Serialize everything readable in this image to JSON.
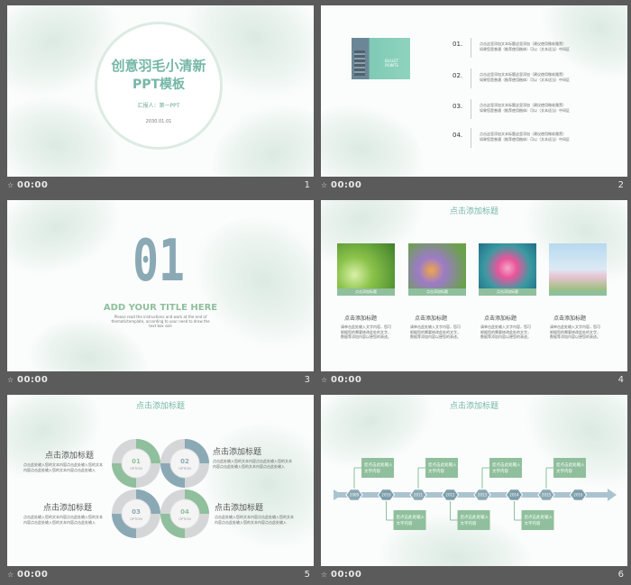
{
  "slides": [
    {
      "number": "1",
      "duration": "00:00",
      "title_line1": "创意羽毛小清新",
      "title_line2": "PPT模板",
      "reporter": "汇报人：第一PPT",
      "date": "2030.01.01"
    },
    {
      "number": "2",
      "duration": "00:00",
      "cover_label": "BULLET\nPOINTS",
      "items": [
        {
          "num": "01.",
          "line1": "点击这里添加文本标题这里添加（建议使用微软雅黑）",
          "line2": "如果您是普通（推荐使用楷体）可以（文本适当）中间区"
        },
        {
          "num": "02.",
          "line1": "点击这里添加文本标题这里添加（建议使用微软雅黑）",
          "line2": "如果您是普通（推荐使用楷体）可以（文本适当）中间区"
        },
        {
          "num": "03.",
          "line1": "点击这里添加文本标题这里添加（建议使用微软雅黑）",
          "line2": "如果您是普通（推荐使用楷体）可以（文本适当）中间区"
        },
        {
          "num": "04.",
          "line1": "点击这里添加文本标题这里添加（建议使用微软雅黑）",
          "line2": "如果您是普通（推荐使用楷体）可以（文本适当）中间区"
        }
      ]
    },
    {
      "number": "3",
      "duration": "00:00",
      "big_number": "01",
      "heading": "ADD YOUR TITLE HERE",
      "sub1": "Please read the instructions and work at the end of",
      "sub2": "thematictemplate, according to your need to draw the",
      "sub3": "text box size"
    },
    {
      "number": "4",
      "duration": "00:00",
      "title": "点击添加标题",
      "cards": [
        {
          "caption": "点击添加标题",
          "heading": "点击添加标题",
          "t1": "请单击此处输入文字内容，您可",
          "t2": "根据您的需要修改此处的文字，",
          "t3": "数据等添加内容以便您的表述。"
        },
        {
          "caption": "点击添加标题",
          "heading": "点击添加标题",
          "t1": "请单击此处输入文字内容，您可",
          "t2": "根据您的需要修改此处的文字，",
          "t3": "数据等添加内容以便您的表述。"
        },
        {
          "caption": "点击添加标题",
          "heading": "点击添加标题",
          "t1": "请单击此处输入文字内容，您可",
          "t2": "根据您的需要修改此处的文字，",
          "t3": "数据等添加内容以便您的表述。"
        },
        {
          "caption": "点击添加标题",
          "heading": "点击添加标题",
          "t1": "请单击此处输入文字内容，您可",
          "t2": "根据您的需要修改此处的文字，",
          "t3": "数据等添加内容以便您的表述。"
        }
      ]
    },
    {
      "number": "5",
      "duration": "00:00",
      "title": "点击添加标题",
      "blocks": [
        {
          "heading": "点击添加标题",
          "t1": "点击此处输入您的文本内容点击此处输入您的文本",
          "t2": "内容点击此处输入您的文本内容点击此处输入"
        },
        {
          "heading": "点击添加标题",
          "t1": "点击此处输入您的文本内容点击此处输入您的文本",
          "t2": "内容点击此处输入您的文本内容点击此处输入"
        },
        {
          "heading": "点击添加标题",
          "t1": "点击此处输入您的文本内容点击此处输入您的文本",
          "t2": "内容点击此处输入您的文本内容点击此处输入"
        },
        {
          "heading": "点击添加标题",
          "t1": "点击此处输入您的文本内容点击此处输入您的文本",
          "t2": "内容点击此处输入您的文本内容点击此处输入"
        }
      ],
      "circles": [
        {
          "num": "01",
          "label": "OPTION"
        },
        {
          "num": "02",
          "label": "OPTION"
        },
        {
          "num": "03",
          "label": "OPTION"
        },
        {
          "num": "04",
          "label": "OPTION"
        }
      ]
    },
    {
      "number": "6",
      "duration": "00:00",
      "title": "点击添加标题",
      "years": [
        "2009",
        "2010",
        "2011",
        "2012",
        "2013",
        "2014",
        "2015",
        "2016"
      ],
      "box_line1": "您点击此处输入",
      "box_line2": "文字内容"
    }
  ],
  "colors": {
    "green": "#8fbf9c",
    "teal": "#75b7a7",
    "slate": "#8aa9b5",
    "dark_bg": "#5b5b5b"
  }
}
